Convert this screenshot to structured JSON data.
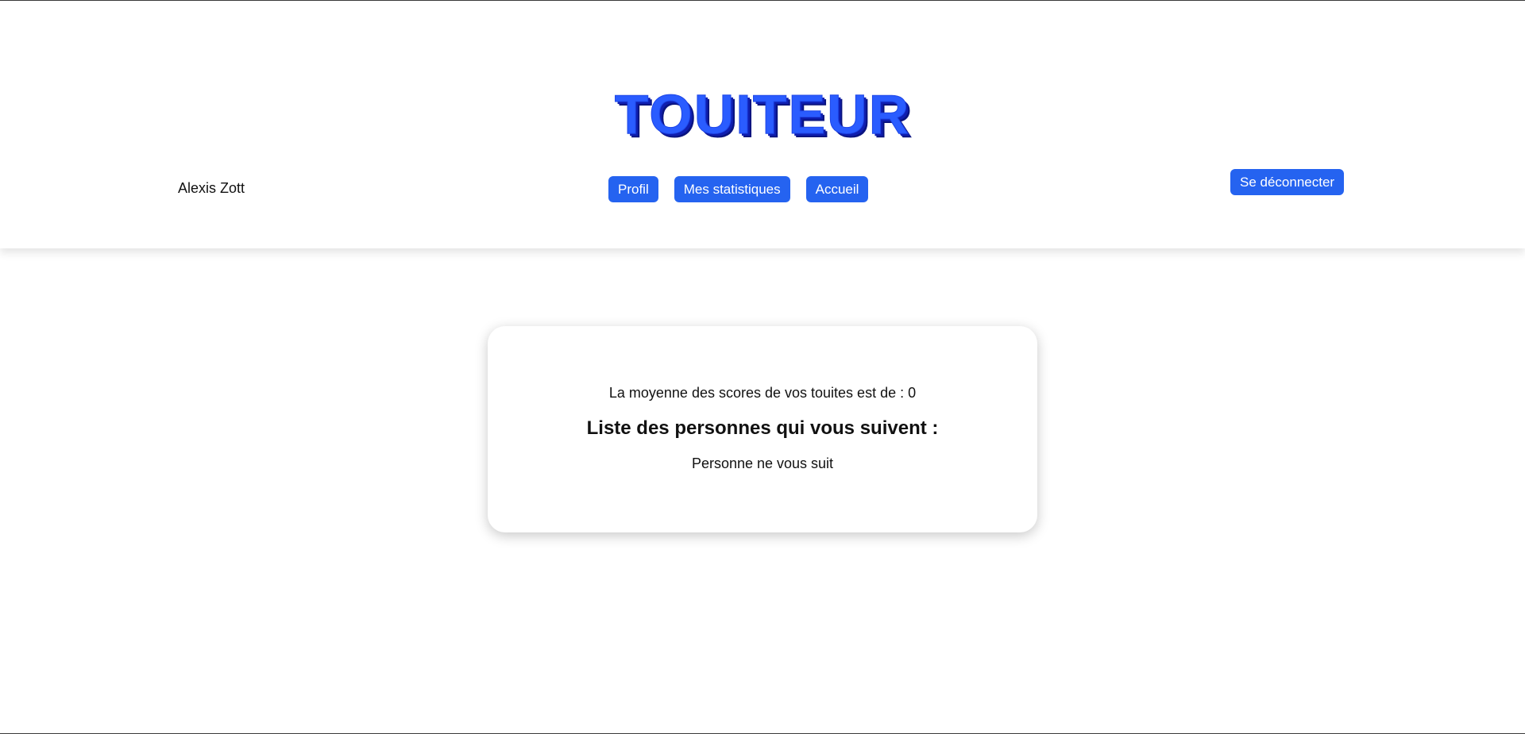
{
  "header": {
    "logo_text": "TOUITEUR",
    "username": "Alexis Zott",
    "nav": {
      "profile_label": "Profil",
      "stats_label": "Mes statistiques",
      "home_label": "Accueil"
    },
    "logout_label": "Se déconnecter"
  },
  "stats": {
    "average_text": "La moyenne des scores de vos touites est de : 0",
    "followers_title": "Liste des personnes qui vous suivent :",
    "no_followers_text": "Personne ne vous suit"
  },
  "colors": {
    "accent": "#2563f0",
    "logo_fill": "#2a5cff",
    "logo_shadow": "#0a1480"
  }
}
